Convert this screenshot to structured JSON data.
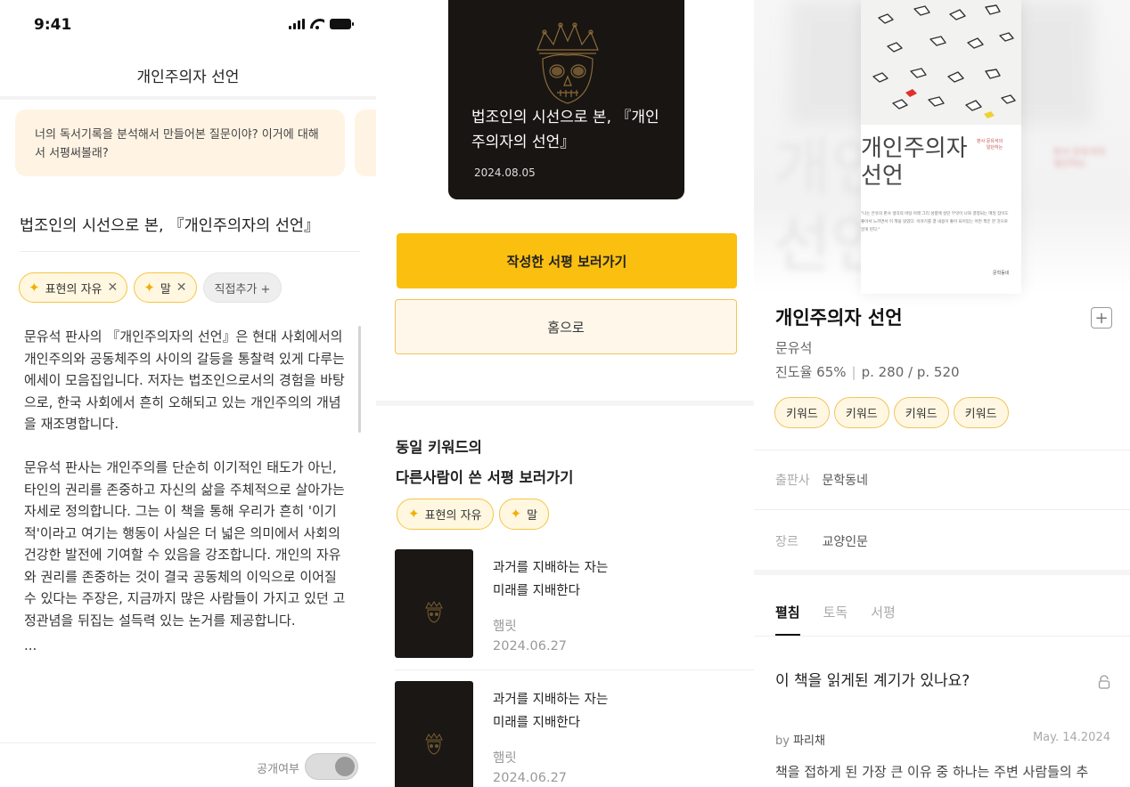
{
  "review_editor": {
    "status_time": "9:41",
    "nav_title": "개인주의자 선언",
    "ai_prompt": "너의 독서기록을 분석해서 만들어본 질문이야? 이거에 대해서 서평써볼래?",
    "review_title": "법조인의 시선으로 본, 『개인주의자의 선언』",
    "keywords": [
      "표현의 자유",
      "말"
    ],
    "add_keyword_label": "직접추가 +",
    "paragraphs": [
      "문유석 판사의 『개인주의자의 선언』은 현대 사회에서의 개인주의와 공동체주의 사이의 갈등을 통찰력 있게 다루는 에세이 모음집입니다. 저자는 법조인으로서의 경험을 바탕으로, 한국 사회에서 흔히 오해되고 있는 개인주의의 개념을 재조명합니다.",
      "문유석 판사는 개인주의를 단순히 이기적인 태도가 아닌, 타인의 권리를 존중하고 자신의 삶을 주체적으로 살아가는 자세로 정의합니다. 그는 이 책을 통해 우리가 흔히 '이기적'이라고 여기는 행동이 사실은 더 넓은 의미에서 사회의 건강한 발전에 기여할 수 있음을 강조합니다. 개인의 자유와 권리를 존중하는 것이 결국 공동체의 이익으로 이어질 수 있다는 주장은, 지금까지 많은 사람들이 가지고 있던 고정관념을 뒤집는 설득력 있는 논거를 제공합니다."
    ],
    "ellipsis": "...",
    "public_toggle_label": "공개여부"
  },
  "review_done": {
    "cover_title": "법조인의 시선으로 본, 『개인주의자의 선언』",
    "cover_date": "2024.08.05",
    "view_review_button": "작성한 서평 보러가기",
    "home_button": "홈으로",
    "section_title_line1": "동일 키워드의",
    "section_title_line2": "다른사람이 쓴 서평 보러가기",
    "keywords": [
      "표현의 자유",
      "말"
    ],
    "reviews": [
      {
        "title_line1": "과거를 지배하는 자는",
        "title_line2": "미래를 지배한다",
        "author": "햄릿",
        "date": "2024.06.27"
      },
      {
        "title_line1": "과거를 지배하는 자는",
        "title_line2": "미래를 지배한다",
        "author": "햄릿",
        "date": "2024.06.27"
      }
    ]
  },
  "book_detail": {
    "cover": {
      "title_line1": "개인주의자",
      "title_line2": "선언",
      "ghost_text": "개인주의\n선언",
      "small_red": "판사 문유석의\n일단하는",
      "publisher": "문학동네"
    },
    "title": "개인주의자 선언",
    "author": "문유석",
    "progress_label": "진도율 65%",
    "pages_label": "p. 280 / p. 520",
    "keywords": [
      "키워드",
      "키워드",
      "키워드",
      "키워드"
    ],
    "publisher_key": "출판사",
    "publisher_value": "문학동네",
    "genre_key": "장르",
    "genre_value": "교양인문",
    "tabs": [
      "펼침",
      "토독",
      "서평"
    ],
    "active_tab": "펼침",
    "question": "이 책을 읽게된 계기가 있나요?",
    "post_by": "by",
    "post_author": "파리채",
    "post_date": "May. 14.2024",
    "post_excerpt": "책을 접하게 된 가장 큰 이유 중 하나는 주변 사람들의 추"
  },
  "colors": {
    "accent": "#fbbf10",
    "chip_border": "#f5c542",
    "chip_bg": "#fff7e0",
    "card_bg": "#fff4e4",
    "dark_cover": "#181512"
  },
  "icons": [
    "signal-icon",
    "wifi-icon",
    "battery-icon",
    "sparkle-icon",
    "close-icon",
    "plus-icon",
    "lock-icon",
    "skull-crown-illustration"
  ]
}
